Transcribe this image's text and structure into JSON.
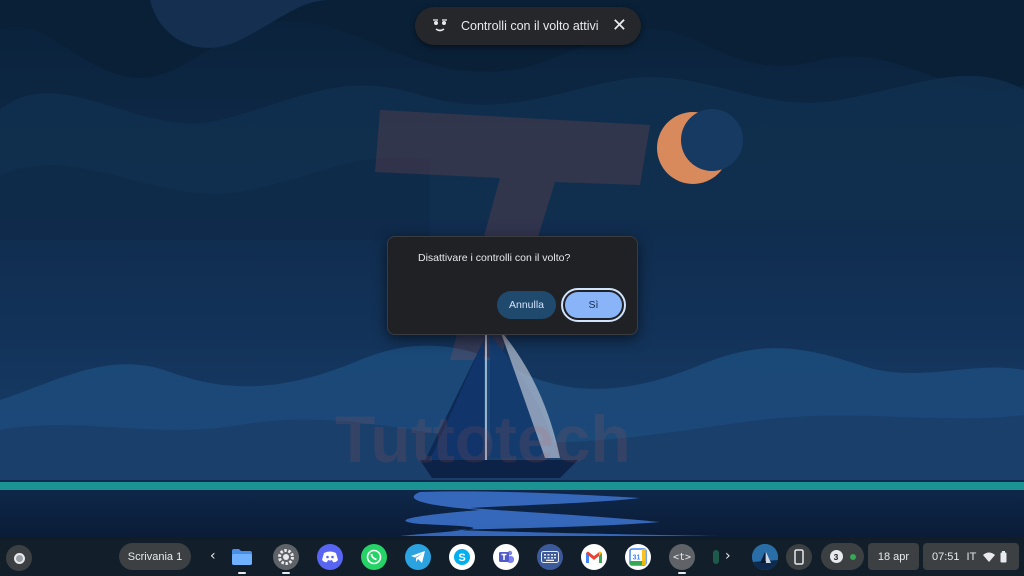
{
  "notification": {
    "text": "Controlli con il volto attivi",
    "icon": "face-control-icon",
    "close_icon": "close-icon"
  },
  "dialog": {
    "title": "Disattivare i controlli con il volto?",
    "cancel_label": "Annulla",
    "confirm_label": "Sì"
  },
  "shelf": {
    "desk_label": "Scrivania 1",
    "prev_icon": "chevron-left-icon",
    "next_icon": "chevron-right-icon",
    "apps": [
      {
        "name": "files-app",
        "icon": "folder-icon",
        "running": true
      },
      {
        "name": "settings-app",
        "icon": "gear-icon",
        "running": true
      },
      {
        "name": "discord-app",
        "icon": "discord-icon",
        "running": false
      },
      {
        "name": "whatsapp-app",
        "icon": "whatsapp-icon",
        "running": false
      },
      {
        "name": "telegram-app",
        "icon": "telegram-icon",
        "running": false
      },
      {
        "name": "skype-app",
        "icon": "skype-icon",
        "running": false
      },
      {
        "name": "teams-app",
        "icon": "teams-icon",
        "running": false
      },
      {
        "name": "keyboard-app",
        "icon": "keyboard-icon",
        "running": false
      },
      {
        "name": "gmail-app",
        "icon": "gmail-icon",
        "running": false
      },
      {
        "name": "calendar-app",
        "icon": "calendar-icon",
        "running": false
      },
      {
        "name": "terminal-app",
        "icon": "terminal-icon",
        "running": true
      }
    ],
    "calendar_number": "31",
    "terminal_glyph": "<t>",
    "notification_count": "3",
    "date": "18 apr",
    "time": "07:51",
    "input_language": "IT",
    "wifi_icon": "wifi-icon",
    "battery_icon": "battery-icon",
    "phone_icon": "phone-hub-icon",
    "avatar_icon": "avatar-icon"
  },
  "colors": {
    "accent": "#8ab4f8",
    "cancel_bg": "#1f4a6e",
    "dialog_bg": "#202124",
    "moon": "#d98a5c",
    "sea_highlight": "#1fa6a0"
  },
  "watermark": {
    "text": "Tuttotech"
  }
}
